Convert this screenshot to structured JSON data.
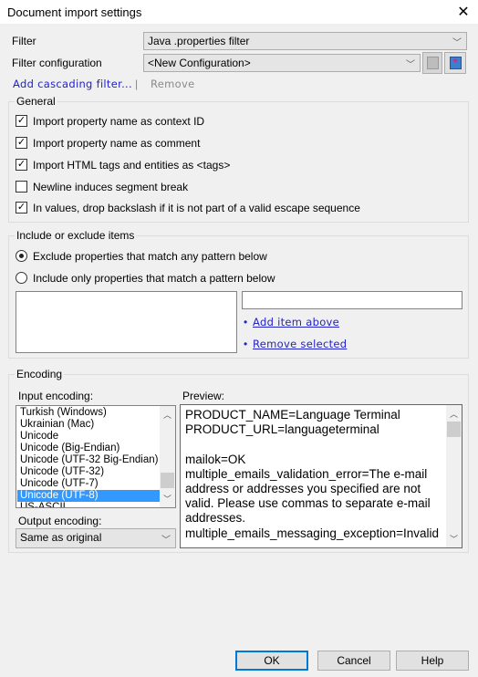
{
  "window": {
    "title": "Document import settings",
    "close_icon": "close-icon"
  },
  "filter": {
    "label": "Filter",
    "value": "Java .properties filter"
  },
  "filter_config": {
    "label": "Filter configuration",
    "value": "<New Configuration>",
    "save_icon": "save-icon",
    "save_as_icon": "save-new-icon"
  },
  "links": {
    "add_cascading": "Add cascading filter...",
    "separator": "|",
    "remove": "Remove"
  },
  "general": {
    "title": "General",
    "options": [
      {
        "label": "Import property name as context ID",
        "checked": true
      },
      {
        "label": "Import property name as comment",
        "checked": true
      },
      {
        "label": "Import HTML tags and entities as <tags>",
        "checked": true
      },
      {
        "label": "Newline induces segment break",
        "checked": false
      },
      {
        "label": "In values, drop backslash if it is not part of a valid escape sequence",
        "checked": true
      }
    ]
  },
  "include": {
    "title": "Include or exclude items",
    "radios": [
      {
        "label": "Exclude properties that match any pattern below",
        "selected": true
      },
      {
        "label": "Include only properties that match a pattern below",
        "selected": false
      }
    ],
    "pattern_value": "",
    "bullet": "•",
    "add_item": "Add item above",
    "remove_selected": "Remove selected"
  },
  "encoding": {
    "title": "Encoding",
    "input_label": "Input encoding:",
    "input_items": [
      "Turkish (Windows)",
      "Ukrainian (Mac)",
      "Unicode",
      "Unicode (Big-Endian)",
      "Unicode (UTF-32 Big-Endian)",
      "Unicode (UTF-32)",
      "Unicode (UTF-7)",
      "Unicode (UTF-8)",
      "US-ASCII"
    ],
    "selected": "Unicode (UTF-8)",
    "output_label": "Output encoding:",
    "output_value": "Same as original",
    "preview_label": "Preview:",
    "preview_text": "PRODUCT_NAME=Language Terminal\nPRODUCT_URL=languageterminal\n\nmailok=OK\nmultiple_emails_validation_error=The e-mail address or addresses you specified are not valid. Please use commas to separate e-mail addresses.\nmultiple_emails_messaging_exception=Invalid"
  },
  "buttons": {
    "ok": "OK",
    "cancel": "Cancel",
    "help": "Help"
  }
}
